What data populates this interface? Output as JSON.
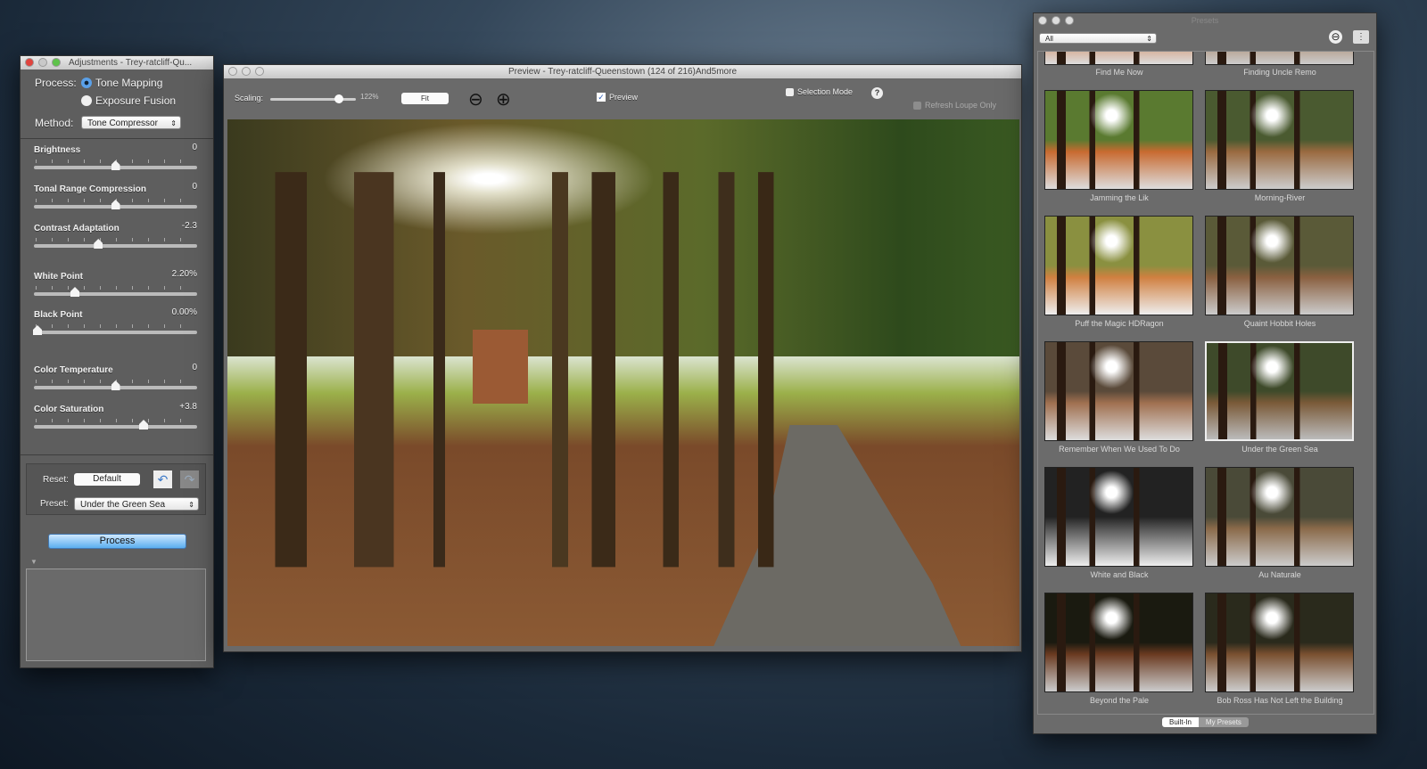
{
  "adjustments": {
    "title": "Adjustments - Trey-ratcliff-Qu...",
    "process_label": "Process:",
    "process_options": [
      "Tone Mapping",
      "Exposure Fusion"
    ],
    "process_selected": "Tone Mapping",
    "method_label": "Method:",
    "method_value": "Tone Compressor",
    "sliders": [
      {
        "name": "Brightness",
        "value": "0",
        "level": 0.5
      },
      {
        "name": "Tonal Range Compression",
        "value": "0",
        "level": 0.5
      },
      {
        "name": "Contrast Adaptation",
        "value": "-2.3",
        "level": 0.39
      },
      {
        "name": "White Point",
        "value": "2.20%",
        "level": 0.24
      },
      {
        "name": "Black Point",
        "value": "0.00%",
        "level": 0.0
      },
      {
        "name": "Color Temperature",
        "value": "0",
        "level": 0.5
      },
      {
        "name": "Color Saturation",
        "value": "+3.8",
        "level": 0.68
      }
    ],
    "reset_label": "Reset:",
    "default_button": "Default",
    "preset_label": "Preset:",
    "preset_value": "Under the Green Sea",
    "process_button": "Process",
    "undo_icon": "undo-arrow-icon",
    "redo_icon": "redo-arrow-icon"
  },
  "preview": {
    "title": "Preview - Trey-ratcliff-Queenstown (124 of 216)And5more",
    "scaling_label": "Scaling:",
    "scaling_value": "122%",
    "scaling_level": 0.8,
    "fit_button": "Fit",
    "preview_label": "Preview",
    "preview_checked": true,
    "selection_mode_label": "Selection Mode",
    "selection_mode_checked": false,
    "help": "?",
    "refresh_loupe_label": "Refresh Loupe Only"
  },
  "presets": {
    "title": "Presets",
    "filter_value": "All",
    "tabs": [
      "Built-In",
      "My Presets"
    ],
    "active_tab": "Built-In",
    "selected": "Under the Green Sea",
    "top_partial": [
      "Find Me Now",
      "Finding Uncle Remo"
    ],
    "items": [
      "Jamming the Lik",
      "Morning-River",
      "Puff the Magic HDRagon",
      "Quaint Hobbit Holes",
      "Remember When We Used To Do",
      "Under the Green Sea",
      "White and Black",
      "Au Naturale",
      "Beyond the Pale",
      "Bob Ross Has Not Left the Building"
    ]
  }
}
